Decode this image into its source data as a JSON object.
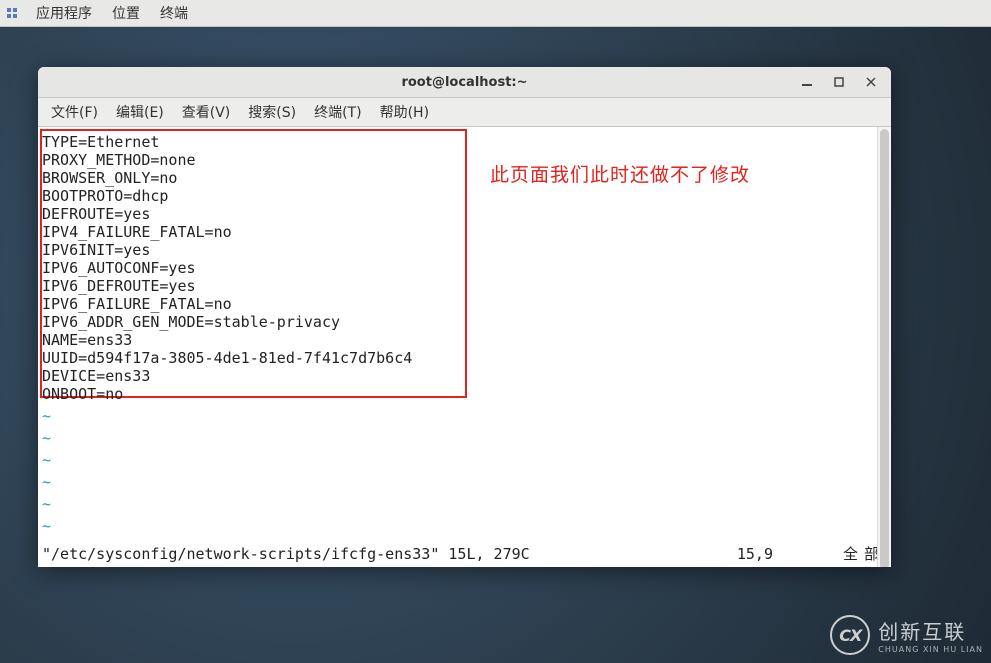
{
  "desktop_menu": {
    "apps": "应用程序",
    "places": "位置",
    "terminal": "终端"
  },
  "window": {
    "title": "root@localhost:~"
  },
  "menubar": {
    "file": "文件(F)",
    "edit": "编辑(E)",
    "view": "查看(V)",
    "search": "搜索(S)",
    "terminal": "终端(T)",
    "help": "帮助(H)"
  },
  "file_lines": [
    "TYPE=Ethernet",
    "PROXY_METHOD=none",
    "BROWSER_ONLY=no",
    "BOOTPROTO=dhcp",
    "DEFROUTE=yes",
    "IPV4_FAILURE_FATAL=no",
    "IPV6INIT=yes",
    "IPV6_AUTOCONF=yes",
    "IPV6_DEFROUTE=yes",
    "IPV6_FAILURE_FATAL=no",
    "IPV6_ADDR_GEN_MODE=stable-privacy",
    "NAME=ens33",
    "UUID=d594f17a-3805-4de1-81ed-7f41c7d7b6c4",
    "DEVICE=ens33",
    "ONBOOT=no"
  ],
  "annotation_text": "此页面我们此时还做不了修改",
  "tilde_lines": "~\n~\n~\n~\n~\n~",
  "status": {
    "file": "\"/etc/sysconfig/network-scripts/ifcfg-ens33\" 15L, 279C",
    "pos": "15,9",
    "all": "全部"
  },
  "watermark": {
    "logo": "CX",
    "cn": "创新互联",
    "en": "CHUANG XIN HU LIAN"
  }
}
